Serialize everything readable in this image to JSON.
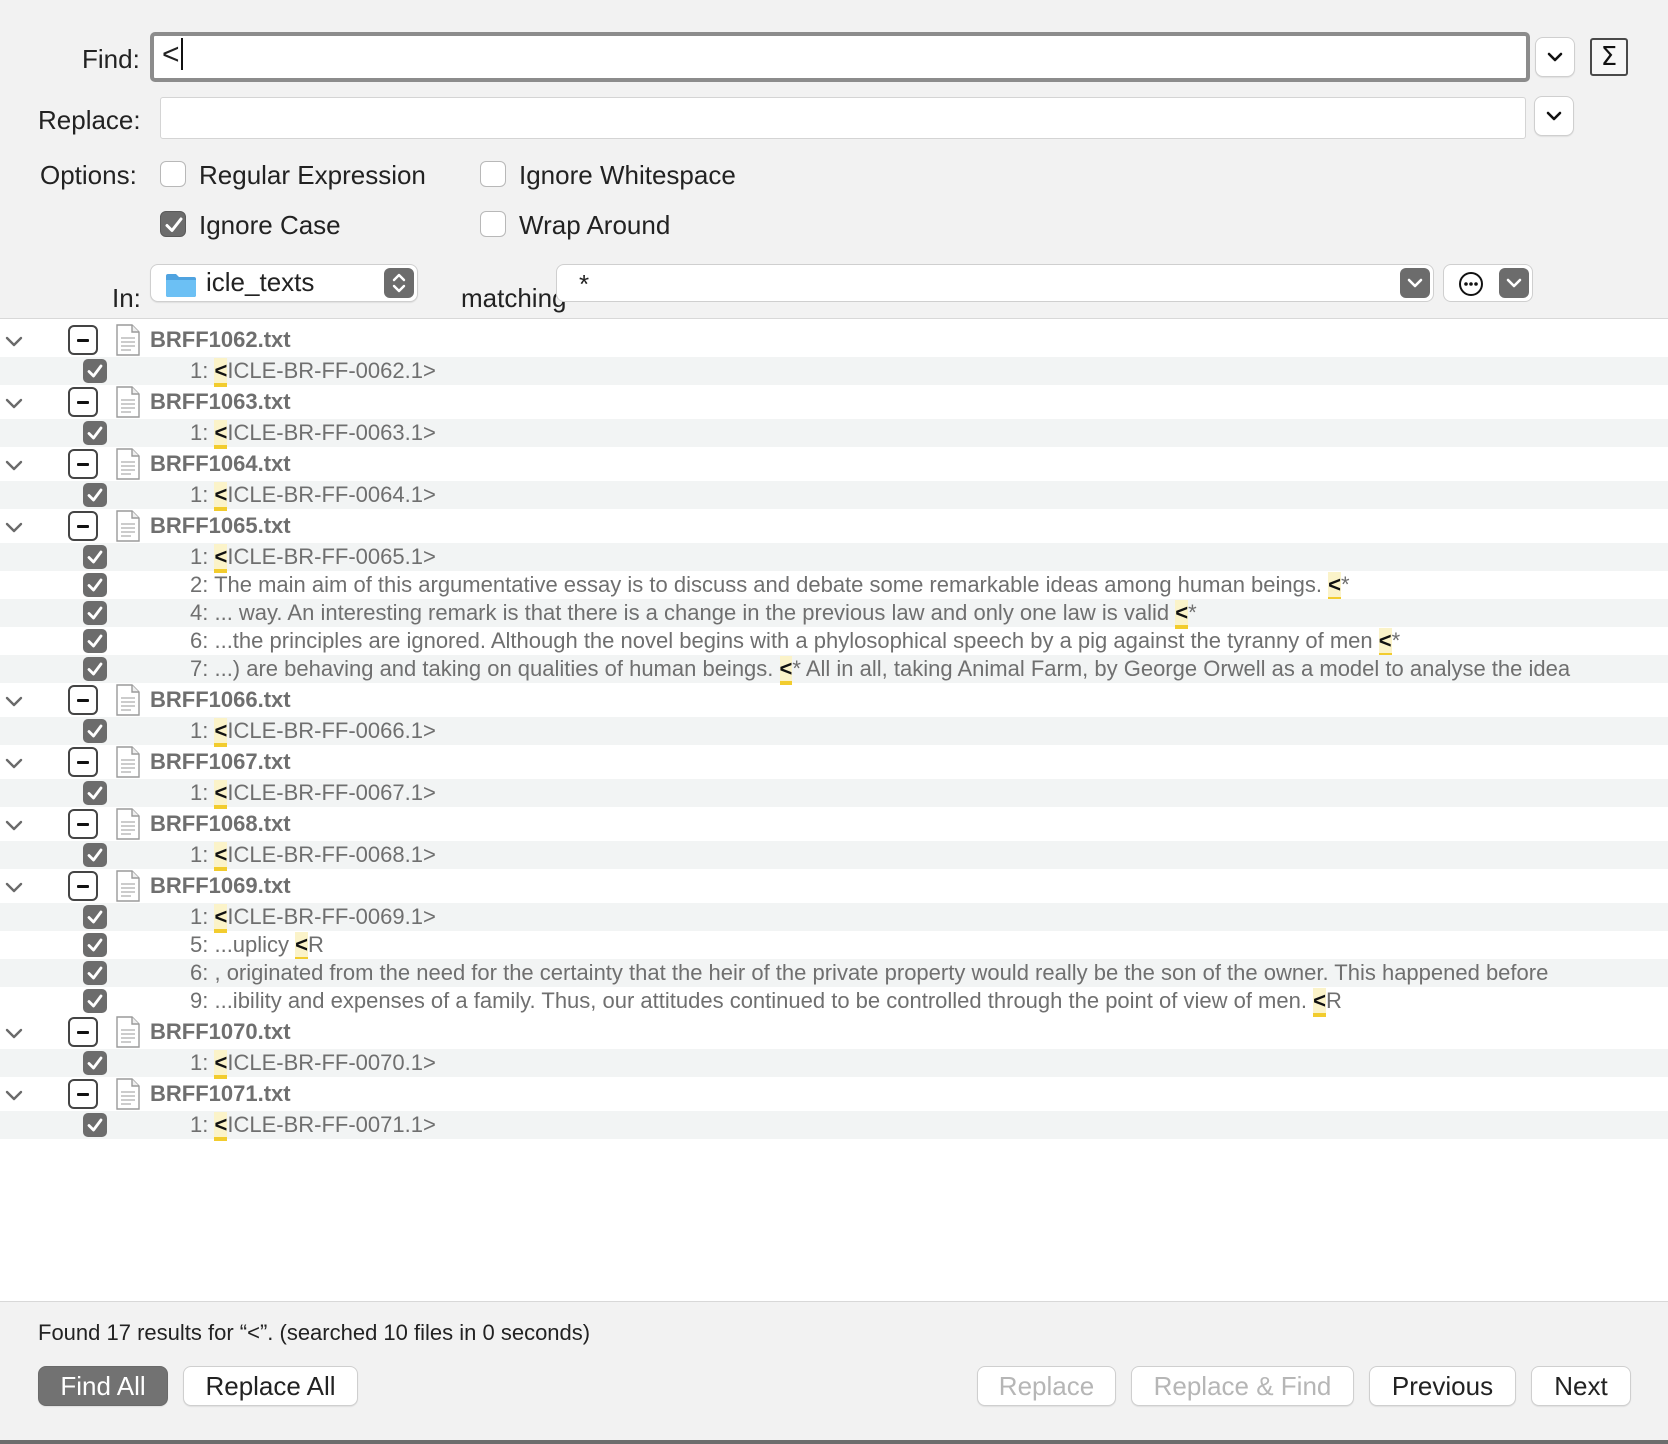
{
  "find": {
    "label": "Find:",
    "value": "<",
    "sigma_label": "Σ"
  },
  "replace": {
    "label": "Replace:",
    "value": ""
  },
  "options": {
    "label": "Options:",
    "regex": {
      "label": "Regular Expression",
      "checked": false
    },
    "ignore_whitespace": {
      "label": "Ignore Whitespace",
      "checked": false
    },
    "ignore_case": {
      "label": "Ignore Case",
      "checked": true
    },
    "wrap_around": {
      "label": "Wrap Around",
      "checked": false
    }
  },
  "scope": {
    "in_label": "In:",
    "folder": "icle_texts",
    "matching_label": "matching",
    "matching_value": "*"
  },
  "results": [
    {
      "file": "BRFF1062.txt",
      "matches": [
        {
          "line": "1:",
          "before": " ",
          "hit": "<",
          "after": "ICLE-BR-FF-0062.1>"
        }
      ]
    },
    {
      "file": "BRFF1063.txt",
      "matches": [
        {
          "line": "1:",
          "before": " ",
          "hit": "<",
          "after": "ICLE-BR-FF-0063.1>"
        }
      ]
    },
    {
      "file": "BRFF1064.txt",
      "matches": [
        {
          "line": "1:",
          "before": " ",
          "hit": "<",
          "after": "ICLE-BR-FF-0064.1>"
        }
      ]
    },
    {
      "file": "BRFF1065.txt",
      "matches": [
        {
          "line": "1:",
          "before": " ",
          "hit": "<",
          "after": "ICLE-BR-FF-0065.1>"
        },
        {
          "line": "2:",
          "before": " The main aim of this argumentative essay is to discuss and debate some remarkable ideas among human beings. ",
          "hit": "<",
          "after": "*"
        },
        {
          "line": "4:",
          "before": " ... way. An interesting remark is that there is a change in the previous law and only one law is valid ",
          "hit": "<",
          "after": "*"
        },
        {
          "line": "6:",
          "before": " ...the principles are ignored. Although the novel begins with a phylosophical speech by a pig against the tyranny of men ",
          "hit": "<",
          "after": "*"
        },
        {
          "line": "7:",
          "before": " ...) are behaving and taking on qualities of human beings. ",
          "hit": "<",
          "after": "* All in all, taking Animal Farm, by George Orwell as a model to analyse the idea"
        }
      ]
    },
    {
      "file": "BRFF1066.txt",
      "matches": [
        {
          "line": "1:",
          "before": " ",
          "hit": "<",
          "after": "ICLE-BR-FF-0066.1>"
        }
      ]
    },
    {
      "file": "BRFF1067.txt",
      "matches": [
        {
          "line": "1:",
          "before": " ",
          "hit": "<",
          "after": "ICLE-BR-FF-0067.1>"
        }
      ]
    },
    {
      "file": "BRFF1068.txt",
      "matches": [
        {
          "line": "1:",
          "before": " ",
          "hit": "<",
          "after": "ICLE-BR-FF-0068.1>"
        }
      ]
    },
    {
      "file": "BRFF1069.txt",
      "matches": [
        {
          "line": "1:",
          "before": " ",
          "hit": "<",
          "after": "ICLE-BR-FF-0069.1>"
        },
        {
          "line": "5:",
          "before": " ...uplicy ",
          "hit": "<",
          "after": "R"
        },
        {
          "line": "6:",
          "before": " , originated from the need for the certainty that the heir of the private property would really be the son of the owner. This happened before",
          "hit": "",
          "after": ""
        },
        {
          "line": "9:",
          "before": " ...ibility and expenses of a family. Thus, our attitudes continued to be controlled through the point of view of men. ",
          "hit": "<",
          "after": "R"
        }
      ]
    },
    {
      "file": "BRFF1070.txt",
      "matches": [
        {
          "line": "1:",
          "before": " ",
          "hit": "<",
          "after": "ICLE-BR-FF-0070.1>"
        }
      ]
    },
    {
      "file": "BRFF1071.txt",
      "matches": [
        {
          "line": "1:",
          "before": " ",
          "hit": "<",
          "after": "ICLE-BR-FF-0071.1>"
        }
      ]
    }
  ],
  "status": "Found 17 results for “<”. (searched 10 files in 0 seconds)",
  "buttons": {
    "find_all": "Find All",
    "replace_all": "Replace All",
    "replace": "Replace",
    "replace_find": "Replace & Find",
    "previous": "Previous",
    "next": "Next"
  },
  "icons": {
    "folder": "folder-icon",
    "document": "document-icon",
    "chevron": "chevron-down-icon",
    "more": "ellipsis-circle-icon"
  },
  "colors": {
    "highlight": "#f2cc2e",
    "checkbox_checked": "#6c6c6c",
    "folder_blue": "#5aaeea"
  }
}
